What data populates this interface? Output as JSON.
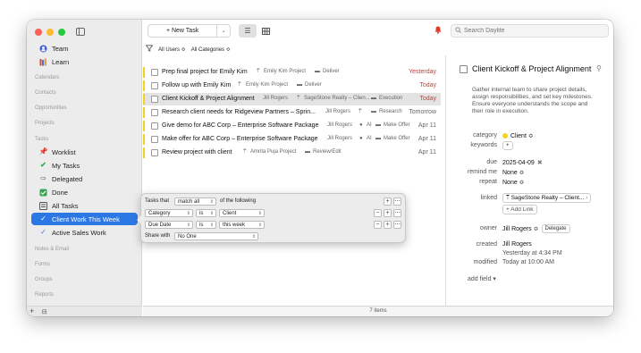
{
  "sidebar": {
    "top_items": [
      {
        "label": "Team",
        "icon": "team-icon"
      },
      {
        "label": "Learn",
        "icon": "books-icon"
      }
    ],
    "sections": {
      "calendars": "Calendars",
      "contacts": "Contacts",
      "opportunities": "Opportunities",
      "projects": "Projects",
      "tasks": "Tasks",
      "notes_email": "Notes & Email",
      "forms": "Forms",
      "groups": "Groups",
      "reports": "Reports"
    },
    "task_items": [
      {
        "label": "Worklist",
        "icon": "pin-icon"
      },
      {
        "label": "My Tasks",
        "icon": "checkmark-icon"
      },
      {
        "label": "Delegated",
        "icon": "arrow-icon"
      },
      {
        "label": "Done",
        "icon": "checkbox-icon"
      },
      {
        "label": "All Tasks",
        "icon": "list-icon"
      },
      {
        "label": "Client Work This Week",
        "icon": "smart-list-icon"
      },
      {
        "label": "Active Sales Work",
        "icon": "smart-list-icon"
      }
    ],
    "footer": {
      "add": "+",
      "settings": "⊟"
    }
  },
  "toolbar": {
    "new_task": "+ New Task",
    "search_placeholder": "Search Daylite"
  },
  "filter": {
    "users": "All Users ≎",
    "categories": "All Categories ≎"
  },
  "tasks": [
    {
      "title": "Prep final project for Emily Kim",
      "project": "Emily Kim Project",
      "stage": "Deliver",
      "due": "Yesterday",
      "due_red": true,
      "owner": ""
    },
    {
      "title": "Follow up with Emily Kim",
      "project": "Emily Kim Project",
      "stage": "Deliver",
      "due": "Today",
      "due_red": true,
      "owner": ""
    },
    {
      "title": "Client Kickoff & Project Alignment",
      "owner": "Jill Rogers",
      "project": "SageStone Realty – Clien...",
      "stage": "Execution",
      "due": "Today",
      "due_red": true
    },
    {
      "title": "Research client needs for Ridgeview Partners – Sprin...",
      "owner": "Jill Rogers",
      "project": "",
      "stage": "Research",
      "due": "Tomorrow",
      "due_red": false
    },
    {
      "title": "Give demo for ABC Corp – Enterprise Software Package",
      "owner": "Jill Rogers",
      "project": "AI",
      "stage": "Make Offer",
      "due": "Apr 11",
      "due_red": false
    },
    {
      "title": "Make offer for ABC Corp – Enterprise Software Package",
      "owner": "Jill Rogers",
      "project": "AI",
      "stage": "Make Offer",
      "due": "Apr 11",
      "due_red": false
    },
    {
      "title": "Review project with client",
      "owner": "",
      "project": "Amrita Puja Project",
      "stage": "Review/Edit",
      "due": "Apr 11",
      "due_red": false
    }
  ],
  "status_bar": "7 items",
  "popover": {
    "tasks_that": "Tasks that",
    "match": "match all",
    "of_following": "of the following",
    "rows": [
      {
        "field": "Category",
        "op": "is",
        "value": "Client"
      },
      {
        "field": "Due Date",
        "op": "is",
        "value": "this week"
      }
    ],
    "share_with_label": "Share with",
    "share_with_value": "No One",
    "plus": "+",
    "minus": "−",
    "more": "⋯"
  },
  "detail": {
    "title": "Client Kickoff & Project Alignment",
    "description": "Gather internal team to share project details, assign responsibilities, and set key milestones. Ensure everyone understands the scope and their role in execution.",
    "labels": {
      "category": "category",
      "keywords": "keywords",
      "due": "due",
      "remind": "remind me",
      "repeat": "repeat",
      "linked": "linked",
      "owner": "owner",
      "created": "created",
      "modified": "modified"
    },
    "category": "Client ≎",
    "keywords_add": "+",
    "due": "2025-04-09",
    "remind": "None ≎",
    "repeat": "None ≎",
    "linked": "SageStone Realty – Client...",
    "add_link": "+ Add Link",
    "owner": "Jill Rogers ≎",
    "delegate": "Delegate",
    "created_by": "Jill Rogers",
    "created_at": "Yesterday at 4:34 PM",
    "modified": "Today at 10:00 AM",
    "add_field": "add field ▾",
    "category_color": "#f4d225"
  }
}
